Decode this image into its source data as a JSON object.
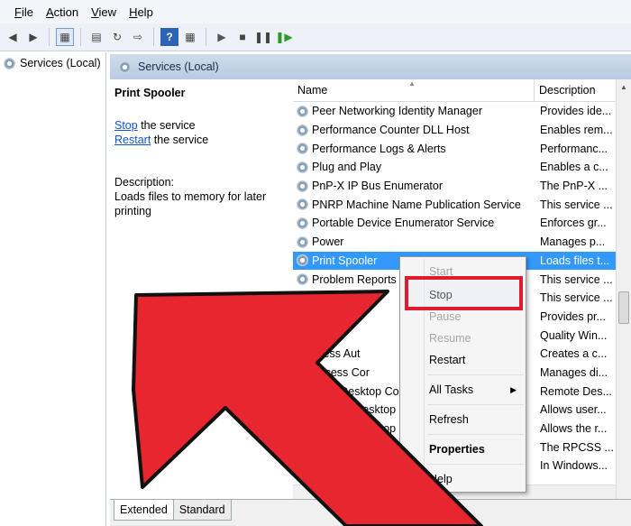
{
  "menu": [
    {
      "key": "F",
      "rest": "ile"
    },
    {
      "key": "A",
      "rest": "ction"
    },
    {
      "key": "V",
      "rest": "iew"
    },
    {
      "key": "H",
      "rest": "elp"
    }
  ],
  "tree": {
    "root": "Services (Local)"
  },
  "header": {
    "title": "Services (Local)"
  },
  "detail": {
    "title": "Print Spooler",
    "stop_link": "Stop",
    "stop_rest": " the service",
    "restart_link": "Restart",
    "restart_rest": " the service",
    "desc_label": "Description:",
    "desc_text": "Loads files to memory for later printing"
  },
  "list": {
    "col_name": "Name",
    "col_desc": "Description",
    "rows": [
      {
        "name": "Peer Networking Identity Manager",
        "desc": "Provides ide..."
      },
      {
        "name": "Performance Counter DLL Host",
        "desc": "Enables rem..."
      },
      {
        "name": "Performance Logs & Alerts",
        "desc": "Performanc..."
      },
      {
        "name": "Plug and Play",
        "desc": "Enables a c..."
      },
      {
        "name": "PnP-X IP Bus Enumerator",
        "desc": "The PnP-X ..."
      },
      {
        "name": "PNRP Machine Name Publication Service",
        "desc": "This service ..."
      },
      {
        "name": "Portable Device Enumerator Service",
        "desc": "Enforces gr..."
      },
      {
        "name": "Power",
        "desc": "Manages p..."
      },
      {
        "name": "Print Spooler",
        "desc": "Loads files t..."
      },
      {
        "name": "Problem Reports a",
        "desc": "This service ..."
      },
      {
        "name": "",
        "desc": "This service ..."
      },
      {
        "name": "",
        "desc": "Provides pr..."
      },
      {
        "name": "                 s A",
        "desc": "Quality Win..."
      },
      {
        "name": "                ccess Aut",
        "desc": "Creates a c..."
      },
      {
        "name": "              Access Cor",
        "desc": "Manages di..."
      },
      {
        "name": "        mote Desktop Co",
        "desc": "Remote Des..."
      },
      {
        "name": "Remote Desktop Se",
        "desc": "Allows user..."
      },
      {
        "name": "Remote Desktop Se",
        "desc": "Allows the r..."
      },
      {
        "name": "Remote Procedure",
        "desc": "The RPCSS ..."
      },
      {
        "name": "Remote Procedure",
        "desc": "In Windows..."
      }
    ]
  },
  "context_menu": {
    "start": "Start",
    "stop": "Stop",
    "pause": "Pause",
    "resume": "Resume",
    "restart": "Restart",
    "all_tasks": "All Tasks",
    "refresh": "Refresh",
    "properties": "Properties",
    "help": "Help"
  },
  "tabs": {
    "extended": "Extended",
    "standard": "Standard"
  },
  "colors": {
    "arrow": "#e8262f",
    "highlight": "#e01b2d",
    "selection": "#3399ff"
  }
}
